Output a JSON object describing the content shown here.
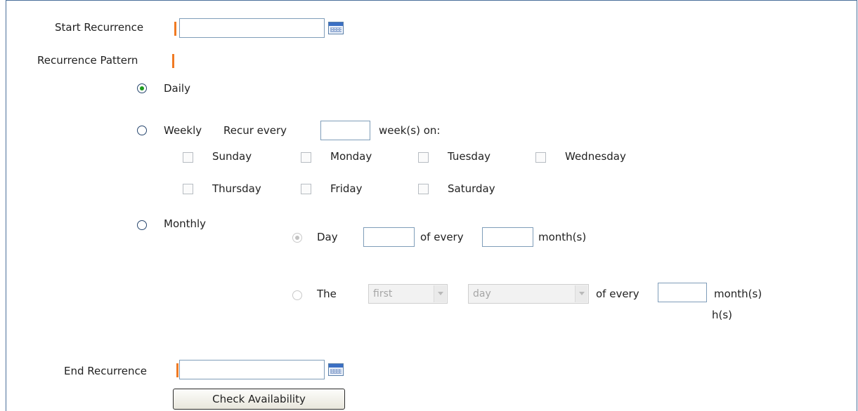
{
  "start_recurrence": {
    "label": "Start Recurrence",
    "value": ""
  },
  "recurrence_pattern": {
    "label": "Recurrence Pattern"
  },
  "daily": {
    "label": "Daily"
  },
  "weekly": {
    "label": "Weekly",
    "recur_every_label": "Recur every",
    "weeks_value": "",
    "weeks_on_label": "week(s) on:",
    "days": [
      "Sunday",
      "Monday",
      "Tuesday",
      "Wednesday",
      "Thursday",
      "Friday",
      "Saturday"
    ]
  },
  "monthly": {
    "label": "Monthly",
    "day_option": {
      "label": "Day",
      "day_value": "",
      "of_every_label": "of every",
      "months_value": "",
      "months_label": "month(s)"
    },
    "the_option": {
      "label": "The",
      "ordinal_selected": "first",
      "weekday_selected": "day",
      "of_every_label": "of every",
      "months_value": "",
      "months_label": "month(s)",
      "overflow_text": "h(s)"
    }
  },
  "end_recurrence": {
    "label": "End Recurrence",
    "value": ""
  },
  "check_availability": {
    "label": "Check Availability"
  },
  "colors": {
    "required_marker": "#f07a23",
    "border": "#4a6f9a",
    "radio_selected": "#1e9b1e"
  }
}
